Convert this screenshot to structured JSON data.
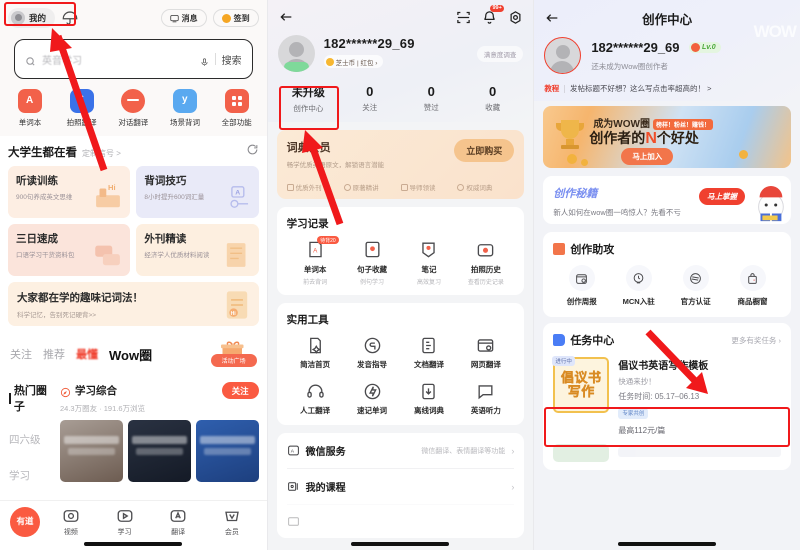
{
  "panel1": {
    "header": {
      "mine_label": "我的",
      "umbrella_icon": "umbrella-icon",
      "messages_label": "消息",
      "checkin_label": "签到"
    },
    "search": {
      "placeholder": "英音学习",
      "mic_icon": "microphone-icon",
      "button_label": "搜索"
    },
    "quick_actions": [
      {
        "label": "单词本",
        "icon": "wordbook-icon",
        "color": "#f2614a"
      },
      {
        "label": "拍照翻译",
        "icon": "camera-translate-icon",
        "color": "#3a72e8"
      },
      {
        "label": "对话翻译",
        "icon": "dialog-translate-icon",
        "color": "#f2614a"
      },
      {
        "label": "场景背词",
        "icon": "scene-words-icon",
        "color": "#5aa9f0"
      },
      {
        "label": "全部功能",
        "icon": "grid-all-icon",
        "color": "#f2614a"
      }
    ],
    "recommend": {
      "title": "大学生都在看",
      "subtitle": "定制信号 >",
      "refresh_icon": "refresh-icon",
      "cards": [
        {
          "title": "听读训练",
          "subtitle": "900句养成英文思维"
        },
        {
          "title": "背词技巧",
          "subtitle": "8小时提升600词汇量"
        },
        {
          "title": "三日速成",
          "subtitle": "口语学习干货资料包"
        },
        {
          "title": "外刊精读",
          "subtitle": "经济学人优质材料阅读"
        }
      ],
      "wide_card": {
        "title": "大家都在学的趣味记词法！",
        "subtitle": "科学记忆，告别死记硬背>>"
      }
    },
    "feed": {
      "tabs": [
        "关注",
        "推荐",
        "最懂",
        "Wow圈"
      ],
      "active_tab": "Wow圈",
      "activity_button": "活动广场",
      "side_items": [
        "热门圈子",
        "四六级",
        "学习"
      ],
      "side_active": "热门圈子",
      "circle": {
        "name": "学习综合",
        "follow_label": "关注",
        "meta": "24.3万圈友 · 191.6万浏览"
      }
    },
    "tabbar": {
      "logo": "有道",
      "items": [
        {
          "label": "视频",
          "icon": "video-icon"
        },
        {
          "label": "学习",
          "icon": "study-icon"
        },
        {
          "label": "翻译",
          "icon": "translate-icon"
        },
        {
          "label": "会员",
          "icon": "vip-icon"
        }
      ]
    }
  },
  "panel2": {
    "nav": {
      "back_icon": "back-arrow-icon",
      "scan_icon": "scan-icon",
      "bell_icon": "bell-icon",
      "bell_badge": "99+",
      "settings_icon": "settings-icon"
    },
    "user": {
      "name": "182******29_69",
      "badge": "芝士币 | 红包 ›",
      "survey_chip": "满意度调查"
    },
    "stats": [
      {
        "value": "未升级",
        "label": "创作中心",
        "highlighted": true
      },
      {
        "value": "0",
        "label": "关注"
      },
      {
        "value": "0",
        "label": "赞过"
      },
      {
        "value": "0",
        "label": "收藏"
      }
    ],
    "vip": {
      "title": "词典会员",
      "subtitle": "畅学优质英语原文，解锁语言潜能",
      "button": "立即购买",
      "features": [
        "优质外刊",
        "原著精讲",
        "导师领读",
        "权威词典"
      ]
    },
    "study_record": {
      "title": "学习记录",
      "items": [
        {
          "label": "单词本",
          "sub": "前去背词",
          "icon": "wordbook-icon",
          "badge": "待背20"
        },
        {
          "label": "句子收藏",
          "sub": "例句学习",
          "icon": "sentence-star-icon"
        },
        {
          "label": "笔记",
          "sub": "高效复习",
          "icon": "note-icon"
        },
        {
          "label": "拍照历史",
          "sub": "查看历史记录",
          "icon": "photo-history-icon"
        }
      ]
    },
    "tools": {
      "title": "实用工具",
      "items": [
        {
          "label": "简洁首页",
          "icon": "simple-home-icon"
        },
        {
          "label": "发音指导",
          "icon": "pronunciation-icon"
        },
        {
          "label": "文档翻译",
          "icon": "doc-translate-icon"
        },
        {
          "label": "网页翻译",
          "icon": "web-translate-icon"
        },
        {
          "label": "人工翻译",
          "icon": "human-translate-icon"
        },
        {
          "label": "速记单词",
          "icon": "quick-words-icon"
        },
        {
          "label": "离线词典",
          "icon": "offline-dict-icon"
        },
        {
          "label": "英语听力",
          "icon": "listening-icon"
        }
      ]
    },
    "rows": [
      {
        "title": "微信服务",
        "sub": "微信翻译、表情翻译等功能",
        "icon": "wechat-icon"
      },
      {
        "title": "我的课程",
        "sub": "",
        "icon": "course-icon"
      }
    ]
  },
  "panel3": {
    "nav": {
      "back_icon": "back-arrow-icon",
      "title": "创作中心"
    },
    "user": {
      "name": "182******29_69",
      "level_badge": "Lv.0",
      "level_icon": "watermelon-icon",
      "subtitle": "还未成为Wow圈创作者",
      "watermark": "WOW"
    },
    "tutorial": {
      "tag": "教程",
      "text": "发帖标题不好想？这么写点击率超高的！ >"
    },
    "banner": {
      "line1": "成为WOW圈",
      "highlights": "榜样！粉丝！赚钱！",
      "line2_a": "创作者的",
      "line2_n": "N",
      "line2_b": "个好处",
      "button": "马上加入"
    },
    "tip": {
      "title": "创作秘籍",
      "subtitle": "新人如何在wow圈一鸣惊人？先看不亏",
      "button": "马上掌握"
    },
    "help": {
      "title": "创作助攻",
      "items": [
        {
          "label": "创作周报",
          "icon": "calendar-report-icon"
        },
        {
          "label": "MCN入驻",
          "icon": "mcn-icon"
        },
        {
          "label": "官方认证",
          "icon": "official-badge-icon"
        },
        {
          "label": "商品橱窗",
          "icon": "shop-window-icon"
        }
      ]
    },
    "task_center": {
      "title": "任务中心",
      "more_label": "更多有奖任务 ›",
      "task": {
        "state": "进行中",
        "thumb_line1": "倡议书",
        "thumb_line2": "写作",
        "name": "倡议书英语写作模板",
        "desc": "快通来抄！",
        "time": "任务时间: 05.17–06.13",
        "tag": "专家共创",
        "price": "最高112元/篇"
      }
    }
  },
  "annotations": {
    "color": "#f0191b",
    "highlights": [
      "panel1-mine-pill",
      "panel2-creator-center-stat",
      "panel3-task-center-header"
    ],
    "arrows": [
      "arrow-to-mine-pill",
      "arrow-to-creator-center",
      "arrow-to-mcn-entry"
    ]
  }
}
